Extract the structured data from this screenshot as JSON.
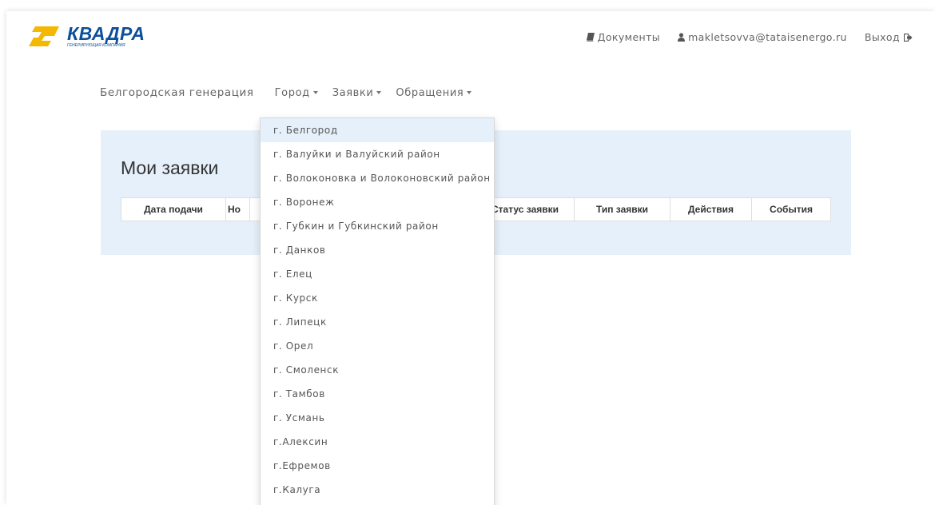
{
  "logo": {
    "name": "КВАДРА",
    "subtitle": "ГЕНЕРИРУЮЩАЯ КОМПАНИЯ",
    "colors": {
      "mark": "#f5b800",
      "text": "#0c4f9a"
    }
  },
  "header": {
    "documents_label": "Документы",
    "documents_icon": "book-icon",
    "user_email": "makletsovva@tataisenergo.ru",
    "user_icon": "user-icon",
    "logout_label": "Выход",
    "logout_icon": "sign-out-icon"
  },
  "nav": {
    "brand": "Белгородская генерация",
    "items": [
      {
        "label": "Город"
      },
      {
        "label": "Заявки"
      },
      {
        "label": "Обращения"
      }
    ]
  },
  "main": {
    "title": "Мои заявки",
    "columns": [
      "Дата подачи",
      "Но",
      "",
      "Статус заявки",
      "Тип заявки",
      "Действия",
      "События"
    ]
  },
  "dropdown": {
    "active_index": 0,
    "items": [
      "г. Белгород",
      "г. Валуйки и Валуйский район",
      "г. Волоконовка и Волоконовский район",
      "г. Воронеж",
      "г. Губкин и Губкинский район",
      "г. Данков",
      "г. Елец",
      "г. Курск",
      "г. Липецк",
      "г. Орел",
      "г. Смоленск",
      "г. Тамбов",
      "г. Усмань",
      "г.Алексин",
      "г.Ефремов",
      "г.Калуга"
    ]
  }
}
